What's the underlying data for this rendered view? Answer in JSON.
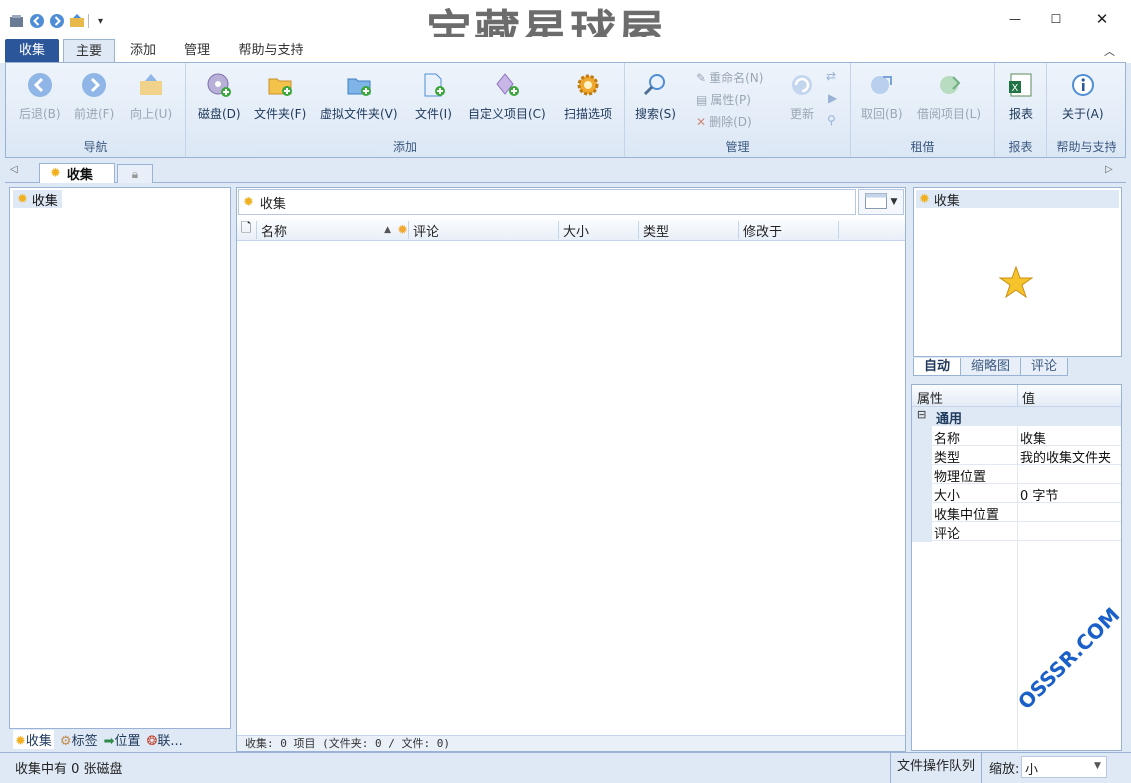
{
  "window": {
    "watermark": "宝藏星球屋",
    "minimize": "—",
    "maximize": "☐",
    "close": "✕"
  },
  "ribbon_tabs": [
    "收集",
    "主要",
    "添加",
    "管理",
    "帮助与支持"
  ],
  "groups": {
    "nav": {
      "label": "导航",
      "back": "后退(B)",
      "forward": "前进(F)",
      "up": "向上(U)"
    },
    "add": {
      "label": "添加",
      "disk": "磁盘(D)",
      "folder": "文件夹(F)",
      "vfolder": "虚拟文件夹(V)",
      "file": "文件(I)",
      "custom": "自定义项目(C)",
      "scan": "扫描选项"
    },
    "manage": {
      "label": "管理",
      "search": "搜索(S)",
      "rename": "重命名(N)",
      "properties": "属性(P)",
      "delete": "删除(D)",
      "update": "更新"
    },
    "lend": {
      "label": "租借",
      "return": "取回(B)",
      "borrow": "借阅项目(L)"
    },
    "report": {
      "label": "报表",
      "report": "报表"
    },
    "help": {
      "label": "帮助与支持",
      "about": "关于(A)"
    }
  },
  "doc_tab": "收集",
  "tree": {
    "root": "收集"
  },
  "left_tabs": [
    "收集",
    "标签",
    "位置",
    "联..."
  ],
  "address": "收集",
  "columns": [
    "名称",
    "评论",
    "大小",
    "类型",
    "修改于"
  ],
  "mid_status": "收集: 0 项目 (文件夹: 0 / 文件: 0)",
  "preview": {
    "title": "收集",
    "tabs": [
      "自动",
      "缩略图",
      "评论"
    ]
  },
  "props": {
    "header_key": "属性",
    "header_val": "值",
    "group": "通用",
    "rows": [
      {
        "k": "名称",
        "v": "收集"
      },
      {
        "k": "类型",
        "v": "我的收集文件夹"
      },
      {
        "k": "物理位置",
        "v": ""
      },
      {
        "k": "大小",
        "v": "0 字节"
      },
      {
        "k": "收集中位置",
        "v": ""
      },
      {
        "k": "评论",
        "v": ""
      }
    ]
  },
  "status": {
    "left": "收集中有 0 张磁盘",
    "queue": "文件操作队列",
    "zoom_label": "缩放:",
    "zoom_value": "小"
  },
  "overlay": "OSSSR.COM"
}
